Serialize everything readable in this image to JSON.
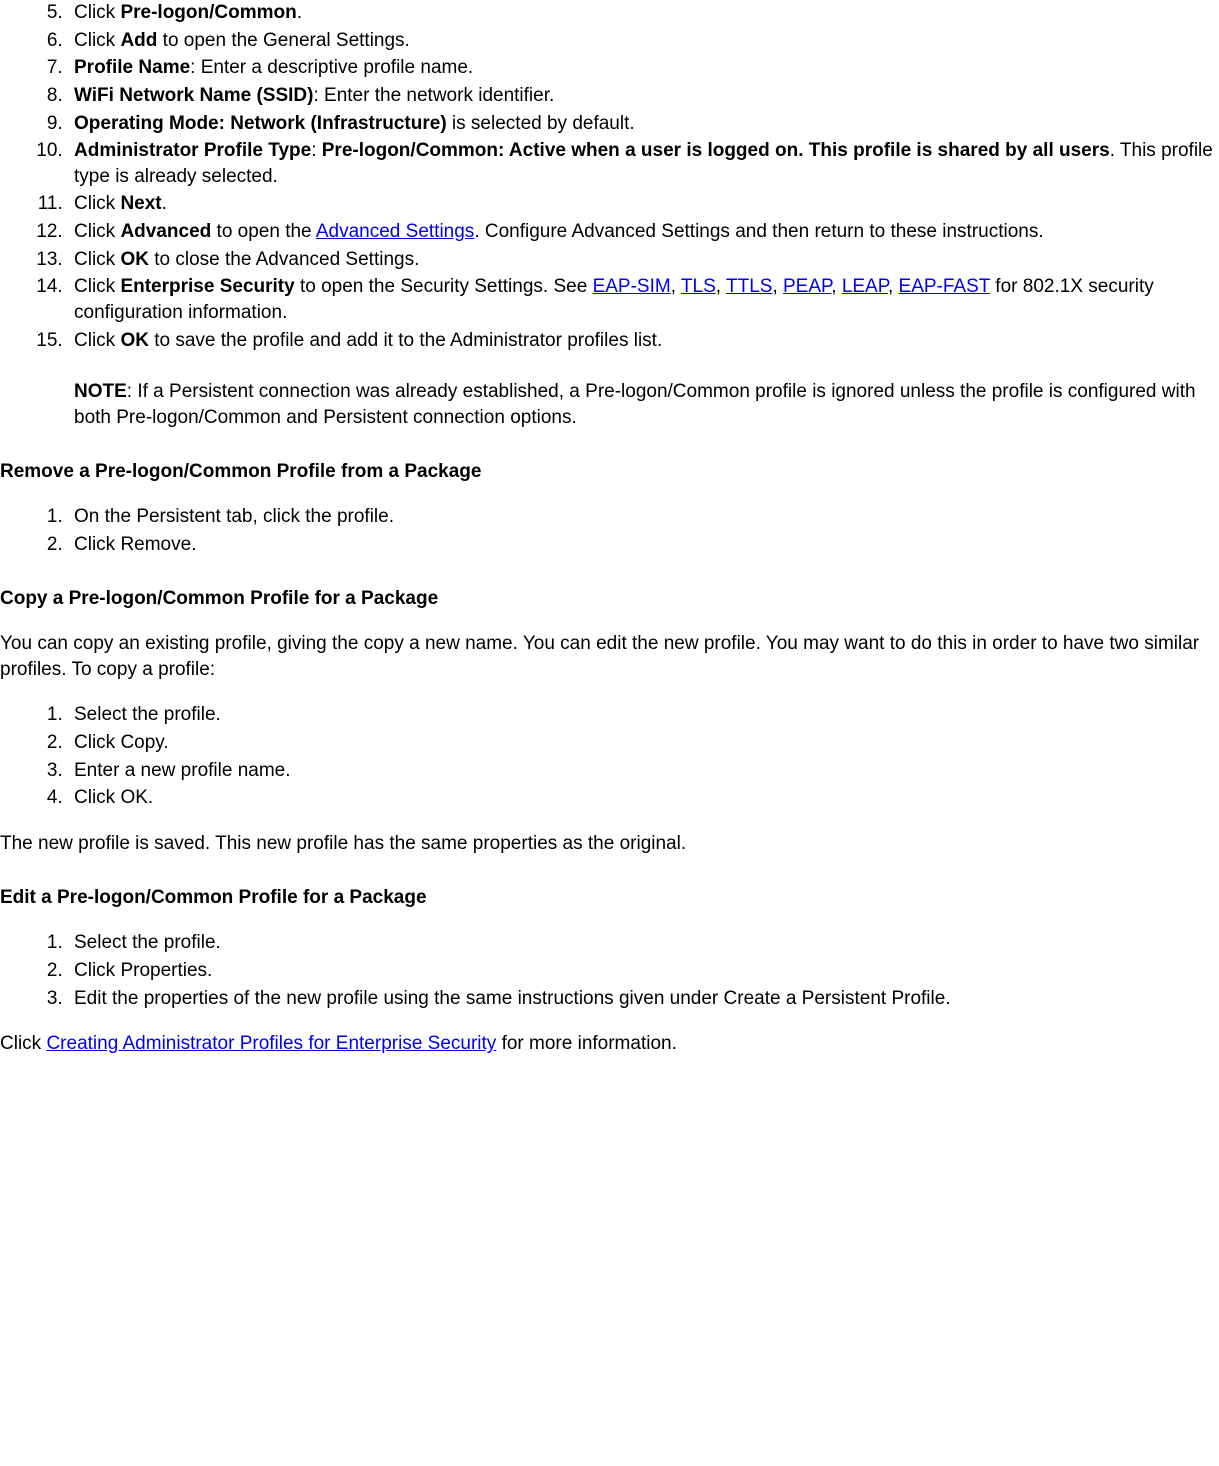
{
  "list1": {
    "start": 5,
    "items": [
      {
        "prefix": "Click ",
        "bold": "Pre-logon/Common",
        "suffix": "."
      },
      {
        "prefix": "Click ",
        "bold": "Add",
        "suffix": " to open the General Settings."
      },
      {
        "bold": "Profile Name",
        "suffix": ": Enter a descriptive profile name."
      },
      {
        "bold": "WiFi Network Name (SSID)",
        "suffix": ": Enter the network identifier."
      },
      {
        "bold": "Operating Mode: Network (Infrastructure)",
        "suffix": " is selected by default."
      },
      {
        "bold": "Administrator Profile Type",
        "mid": ": ",
        "bold2": "Pre-logon/Common: Active when a user is logged on. This profile is shared by all users",
        "suffix": ". This profile type is already selected."
      },
      {
        "prefix": "Click ",
        "bold": "Next",
        "suffix": "."
      },
      {
        "prefix": "Click ",
        "bold": "Advanced",
        "mid": " to open the ",
        "link": "Advanced Settings",
        "suffix": ". Configure Advanced Settings and then return to these instructions."
      },
      {
        "prefix": "Click ",
        "bold": "OK",
        "suffix": " to close the Advanced Settings."
      },
      {
        "prefix": "Click ",
        "bold": "Enterprise Security",
        "mid": " to open the Security Settings. See ",
        "links": [
          "EAP-SIM",
          "TLS",
          "TTLS",
          "PEAP",
          "LEAP",
          "EAP-FAST"
        ],
        "sep": ", ",
        "suffix": " for 802.1X security configuration information."
      },
      {
        "prefix": "Click ",
        "bold": "OK",
        "suffix": " to save the profile and add it to the Administrator profiles list.",
        "note_label": "NOTE",
        "note_text": ": If a Persistent connection was already established, a Pre-logon/Common profile is ignored unless the profile is configured with both Pre-logon/Common and Persistent connection options."
      }
    ]
  },
  "heading_remove": "Remove a Pre-logon/Common Profile from a Package",
  "list_remove": [
    "On the Persistent tab, click the profile.",
    "Click Remove."
  ],
  "heading_copy": "Copy a Pre-logon/Common Profile for a Package",
  "para_copy": "You can copy an existing profile, giving the copy a new name. You can edit the new profile. You may want to do this in order to have two similar profiles. To copy a profile:",
  "list_copy": [
    "Select the profile.",
    "Click Copy.",
    "Enter a new profile name.",
    "Click OK."
  ],
  "para_copy_after": "The new profile is saved. This new profile has the same properties as the original.",
  "heading_edit": "Edit a Pre-logon/Common Profile for a Package",
  "list_edit": [
    "Select the profile.",
    "Click Properties.",
    "Edit the properties of the new profile using the same instructions given under Create a Persistent Profile."
  ],
  "footer_prefix": "Click ",
  "footer_link": "Creating Administrator Profiles for Enterprise Security",
  "footer_suffix": " for more information."
}
